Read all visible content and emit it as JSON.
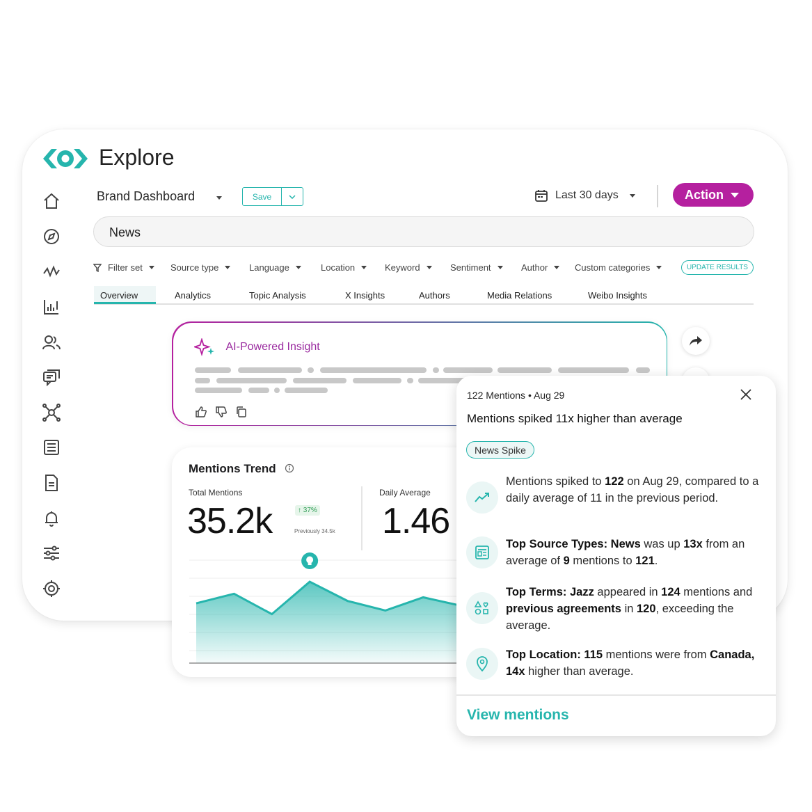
{
  "app": {
    "title": "Explore"
  },
  "toolbar": {
    "dashboard_name": "Brand Dashboard",
    "save_label": "Save",
    "date_range": "Last 30 days",
    "action_label": "Action"
  },
  "search": {
    "value": "News"
  },
  "filters": [
    "Filter set",
    "Source type",
    "Language",
    "Location",
    "Keyword",
    "Sentiment",
    "Author",
    "Custom categories"
  ],
  "update_label": "UPDATE RESULTS",
  "tabs": [
    "Overview",
    "Analytics",
    "Topic Analysis",
    "X Insights",
    "Authors",
    "Media Relations",
    "Weibo Insights"
  ],
  "ai_insight": {
    "title": "AI-Powered Insight"
  },
  "mentions_trend": {
    "title": "Mentions Trend",
    "total_label": "Total Mentions",
    "total_value": "35.2k",
    "change": "↑ 37%",
    "previous": "Previously 34.5k",
    "daily_label": "Daily Average",
    "daily_value": "1.46"
  },
  "chart_data": {
    "type": "area",
    "values": [
      44,
      52,
      35,
      62,
      46,
      38,
      49,
      42,
      41
    ],
    "ylim": [
      0,
      80
    ],
    "peak_marker_index": 3,
    "color": "#26b5ad"
  },
  "popup": {
    "meta": "122 Mentions • Aug 29",
    "headline": "Mentions spiked 11x higher than average",
    "badge": "News Spike",
    "insights": [
      {
        "icon": "trend-up-icon",
        "segments": [
          [
            "t",
            "Mentions spiked to "
          ],
          [
            "b",
            "122"
          ],
          [
            "t",
            " on Aug 29, compared to a daily average of 11 in the previous period."
          ]
        ]
      },
      {
        "icon": "news-icon",
        "segments": [
          [
            "b",
            "Top Source Types: News"
          ],
          [
            "t",
            " was up "
          ],
          [
            "b",
            "13x"
          ],
          [
            "t",
            " from an average of "
          ],
          [
            "b",
            "9"
          ],
          [
            "t",
            " mentions to "
          ],
          [
            "b",
            "121"
          ],
          [
            "t",
            "."
          ]
        ]
      },
      {
        "icon": "terms-icon",
        "segments": [
          [
            "b",
            "Top Terms: Jazz"
          ],
          [
            "t",
            " appeared in "
          ],
          [
            "b",
            "124"
          ],
          [
            "t",
            " mentions and "
          ],
          [
            "b",
            "previous agreements"
          ],
          [
            "t",
            " in "
          ],
          [
            "b",
            "120"
          ],
          [
            "t",
            ", exceeding the average."
          ]
        ]
      },
      {
        "icon": "location-pin-icon",
        "segments": [
          [
            "b",
            "Top Location: 115"
          ],
          [
            "t",
            " mentions were from "
          ],
          [
            "b",
            "Canada, 14x"
          ],
          [
            "t",
            " higher than average."
          ]
        ]
      }
    ],
    "view_link": "View mentions"
  },
  "colors": {
    "accent": "#26b5ad",
    "brand": "#b5209f"
  }
}
